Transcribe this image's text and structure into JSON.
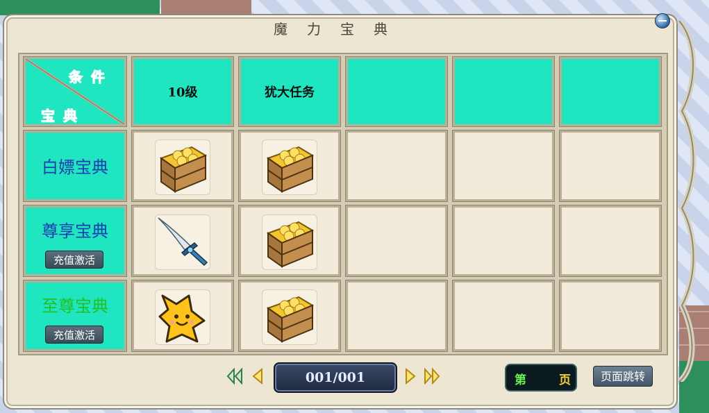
{
  "window": {
    "title": "魔力宝典"
  },
  "corner_header": {
    "condition_label": "条件",
    "book_label": "宝典"
  },
  "columns": [
    "10级",
    "犹大任务",
    "",
    "",
    ""
  ],
  "rows": [
    {
      "label": "白嫖宝典",
      "label_color": "#1a3fb0",
      "button": "",
      "items": [
        "gold-crate-icon",
        "gold-crate-icon"
      ]
    },
    {
      "label": "尊享宝典",
      "label_color": "#1a3fb0",
      "button": "充值激活",
      "items": [
        "sword-icon",
        "gold-crate-icon"
      ]
    },
    {
      "label": "至尊宝典",
      "label_color": "#22c026",
      "button": "充值激活",
      "items": [
        "star-pet-icon",
        "gold-crate-icon"
      ]
    }
  ],
  "pager": {
    "page_display": "001/001"
  },
  "page_jump": {
    "prefix": "第",
    "suffix": "页",
    "button": "页面跳转"
  },
  "colors": {
    "header_cyan": "#1fe6c0",
    "cell_cream": "#f3ebd9"
  }
}
